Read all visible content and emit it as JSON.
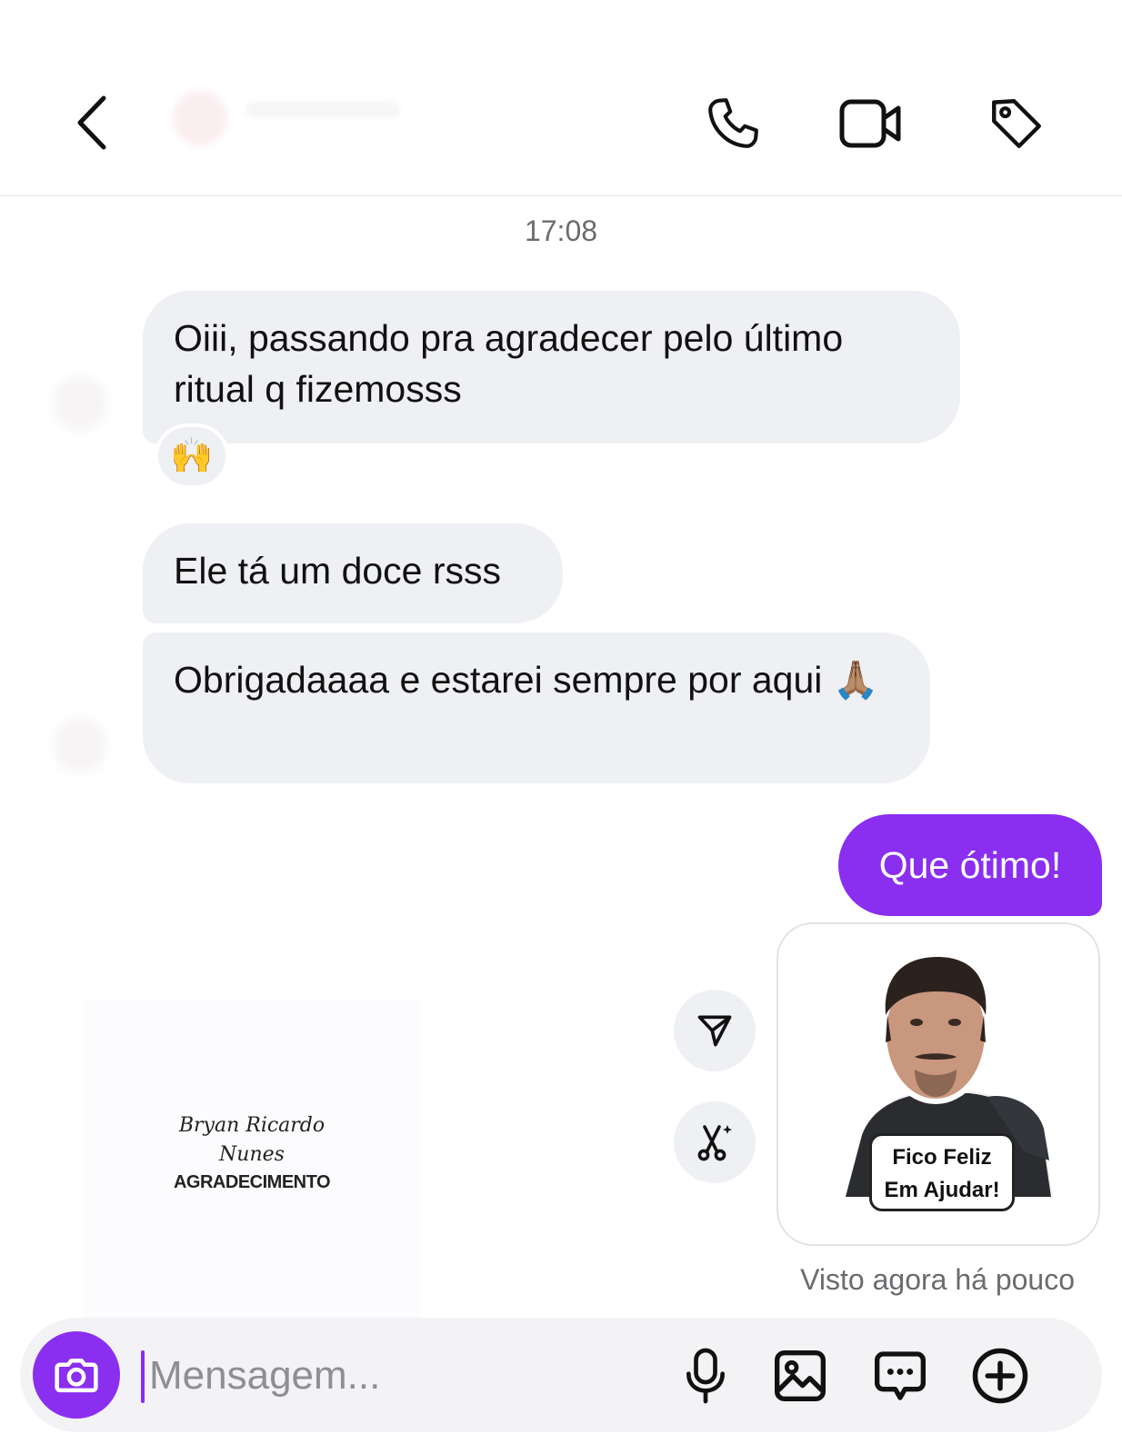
{
  "header": {
    "back_icon": "chevron-left-icon",
    "actions": [
      "phone-icon",
      "video-camera-icon",
      "tag-icon"
    ]
  },
  "chat": {
    "timestamp": "17:08",
    "messages": [
      {
        "direction": "in",
        "text": "Oiii, passando pra agradecer pelo último ritual q fizemosss",
        "reaction": "🙌"
      },
      {
        "direction": "in",
        "text": "Ele tá um doce rsss"
      },
      {
        "direction": "in",
        "text": "Obrigadaaaa e estarei sempre por aqui 🙏🏽"
      },
      {
        "direction": "out",
        "text": "Que ótimo!"
      }
    ],
    "sticker": {
      "caption_line1": "Fico Feliz",
      "caption_line2": "Em Ajudar!"
    },
    "sticker_actions": [
      "send-icon",
      "scissors-sparkle-icon"
    ],
    "seen_text": "Visto agora há pouco"
  },
  "watermark": {
    "line1": "Bryan Ricardo",
    "line2": "Nunes",
    "line3": "AGRADECIMENTO"
  },
  "composer": {
    "placeholder": "Mensagem...",
    "actions": [
      "microphone-icon",
      "image-icon",
      "chat-bubble-icon",
      "plus-circle-icon"
    ]
  },
  "colors": {
    "accent": "#8a2ef0",
    "incoming_bubble": "#eff0f3",
    "meta_text": "#6b6b70"
  }
}
